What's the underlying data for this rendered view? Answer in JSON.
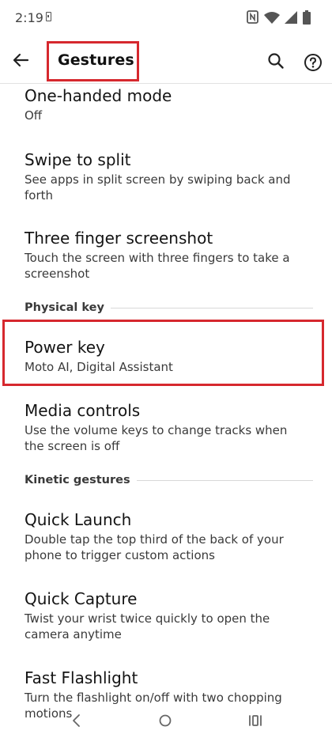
{
  "status_bar": {
    "time": "2:19",
    "icons": [
      "sim-card-icon",
      "nfc-icon",
      "wifi-icon",
      "cell-signal-icon",
      "battery-icon"
    ]
  },
  "app_bar": {
    "title": "Gestures",
    "icons": [
      "back-arrow-icon",
      "search-icon",
      "help-icon"
    ]
  },
  "settings": [
    {
      "title": "One-handed mode",
      "summary": "Off"
    },
    {
      "title": "Swipe to split",
      "summary": "See apps in split screen by swiping back and forth"
    },
    {
      "title": "Three finger screenshot",
      "summary": "Touch the screen with three fingers to take a screenshot"
    },
    {
      "title": "Power key",
      "summary": "Moto AI, Digital Assistant"
    },
    {
      "title": "Media controls",
      "summary": "Use the volume keys to change tracks when the screen is off"
    },
    {
      "title": "Quick Launch",
      "summary": "Double tap the top third of the back of your phone to trigger custom actions"
    },
    {
      "title": "Quick Capture",
      "summary": "Twist your wrist twice quickly to open the camera anytime"
    },
    {
      "title": "Fast Flashlight",
      "summary": "Turn the flashlight on/off with two chopping motions"
    }
  ],
  "sections": {
    "physical_key": "Physical key",
    "kinetic_gestures": "Kinetic gestures"
  },
  "highlight_color": "#d6282e",
  "nav_bar": {
    "icons": [
      "nav-back-icon",
      "nav-home-icon",
      "nav-recents-icon"
    ]
  }
}
